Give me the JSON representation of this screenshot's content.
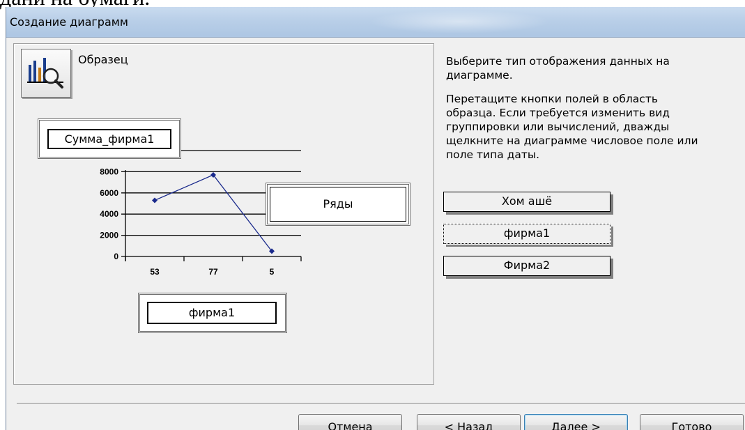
{
  "document": {
    "text_fragment": "дани на бумаги."
  },
  "window": {
    "title": "Создание диаграмм"
  },
  "sample": {
    "label": "Образец",
    "value_field": "Сумма_фирма1",
    "series_field": "Ряды",
    "axis_field": "фирма1"
  },
  "chart_data": {
    "type": "line",
    "categories": [
      "53",
      "77",
      "5"
    ],
    "series": [
      {
        "values": [
          5300,
          7700,
          500
        ]
      }
    ],
    "y_ticks": [
      "8000",
      "6000",
      "4000",
      "2000",
      "0"
    ],
    "ylim": [
      0,
      10000
    ],
    "grid": true,
    "line_color": "#1a2a8c"
  },
  "instructions": {
    "line1": "Выберите тип отображения данных на",
    "line2": "диаграмме.",
    "para2": [
      "Перетащите кнопки полей в область",
      "образца. Если требуется изменить вид",
      "группировки или вычислений, дважды",
      "щелкните на диаграмме числовое поле или",
      "поле типа даты."
    ]
  },
  "fields": [
    "Хом ашё",
    "фирма1",
    "Фирма2"
  ],
  "buttons": {
    "cancel": "Отмена",
    "back_prefix": "< ",
    "back_underline": "Н",
    "back_rest": "азад",
    "next_underline": "Д",
    "next_rest": "алее >",
    "finish_underline": "Г",
    "finish_rest": "отово"
  },
  "icons": {
    "sample_button": "chart-magnifier-icon"
  }
}
